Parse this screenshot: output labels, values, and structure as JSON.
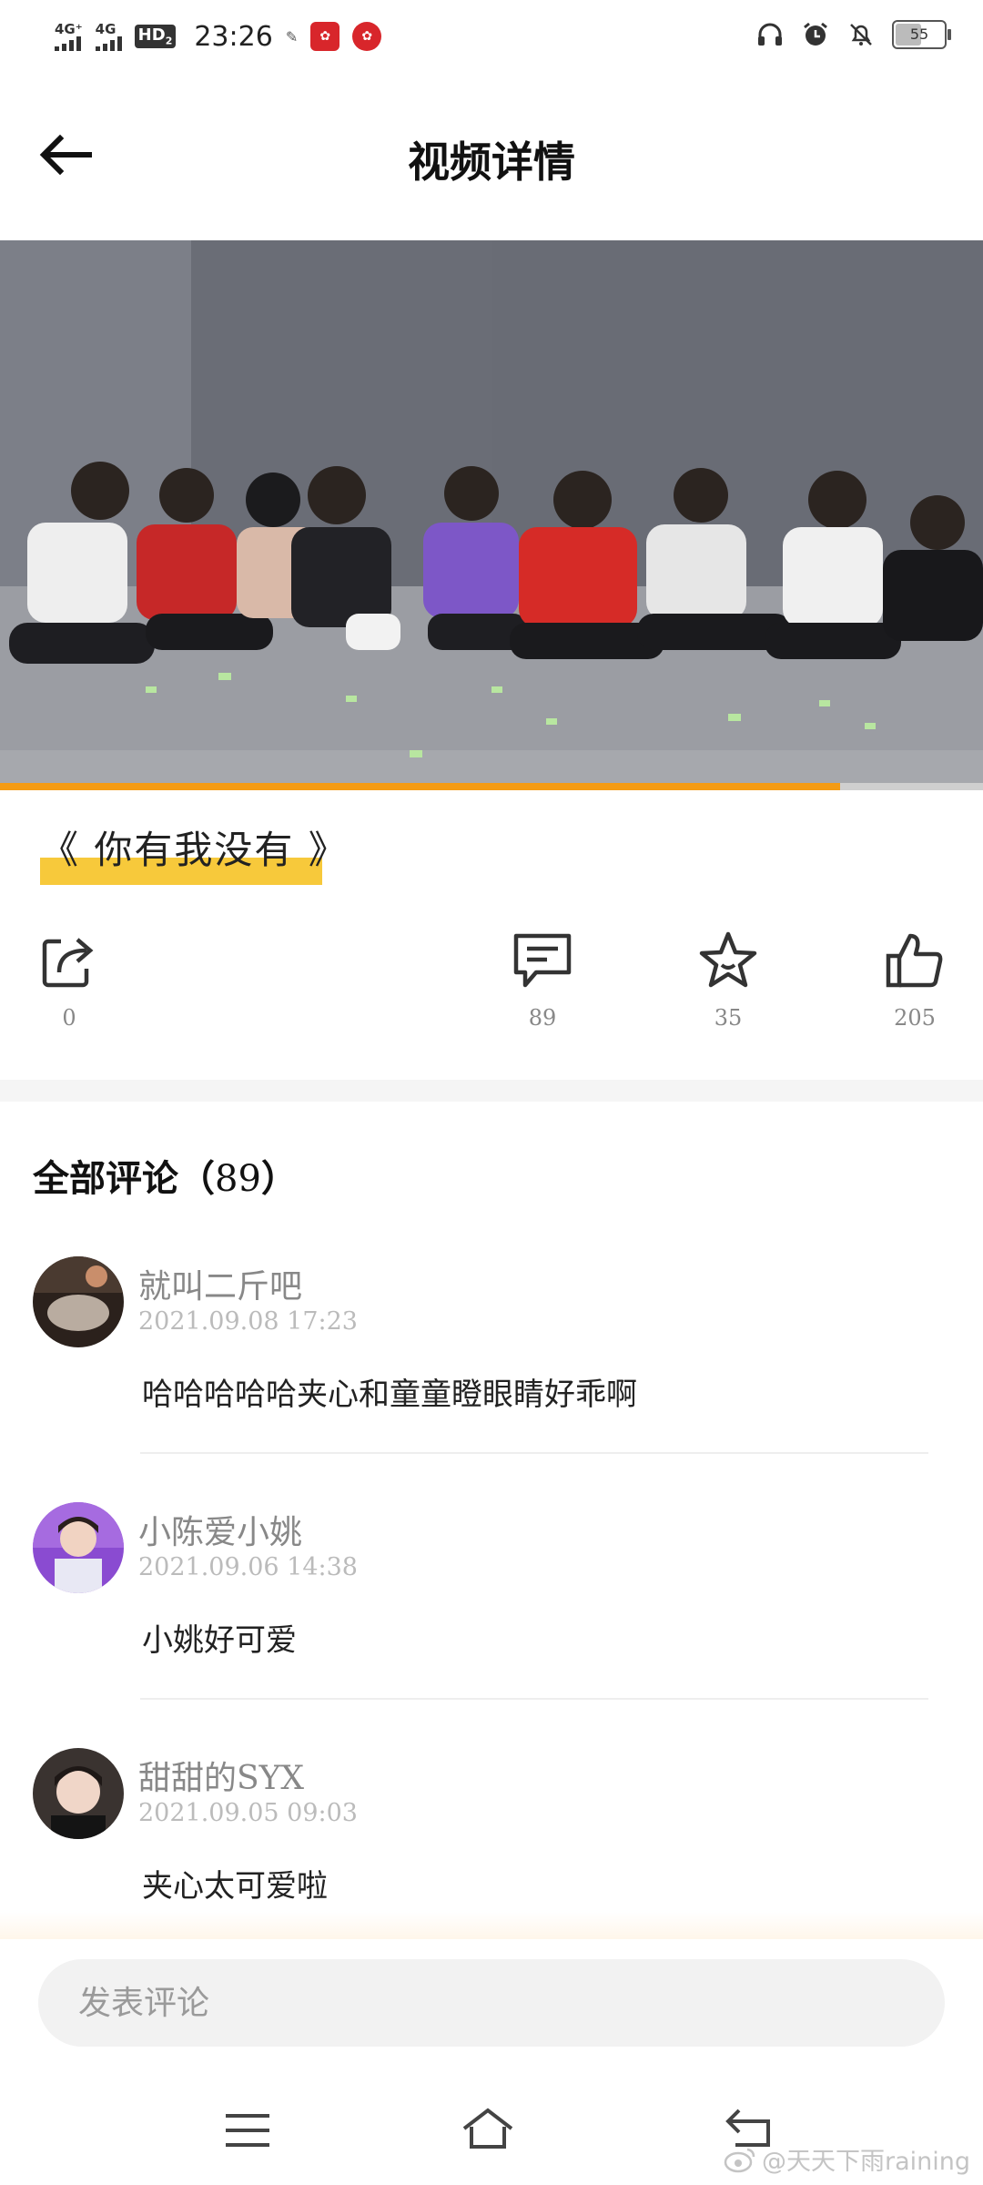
{
  "status_bar": {
    "signal_1": "4G⁺",
    "signal_2": "4G",
    "hd": "HD",
    "hd_sub": "2",
    "time": "23:26",
    "battery": "55"
  },
  "header": {
    "title": "视频详情"
  },
  "video": {
    "progress_percent": 85.5
  },
  "video_title": "《 你有我没有 》",
  "actions": {
    "share_count": "0",
    "comment_count": "89",
    "favorite_count": "35",
    "like_count": "205"
  },
  "comments_header": {
    "label": "全部评论（",
    "count": "89",
    "close": "）"
  },
  "comments": [
    {
      "user": "就叫二斤吧",
      "time": "2021.09.08 17:23",
      "text": "哈哈哈哈哈夹心和童童瞪眼睛好乖啊"
    },
    {
      "user": "小陈爱小姚",
      "time": "2021.09.06 14:38",
      "text": "小姚好可爱"
    },
    {
      "user": "甜甜的SYX",
      "time": "2021.09.05 09:03",
      "text": "夹心太可爱啦"
    }
  ],
  "input": {
    "placeholder": "发表评论"
  },
  "watermark": "@天天下雨raining",
  "colors": {
    "accent": "#f49b14",
    "highlight": "#f7c93b"
  }
}
